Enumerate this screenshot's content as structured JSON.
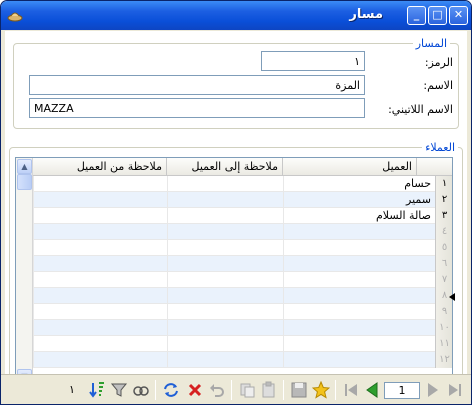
{
  "window": {
    "title": "مسار",
    "close_glyph": "✕",
    "maximize_glyph": "□",
    "minimize_glyph": "_"
  },
  "route_group": {
    "legend": "المسار",
    "code_label": "الرمز:",
    "code_value": "١",
    "name_label": "الاسم:",
    "name_value": "المزة",
    "latin_name_label": "الاسم اللاتيني:",
    "latin_name_value": "MAZZA"
  },
  "clients_group": {
    "legend": "العملاء",
    "columns": [
      "العميل",
      "ملاحظة إلى العميل",
      "ملاحظة من العميل"
    ],
    "rows": [
      {
        "num": "١",
        "client": "حسام",
        "note_to": "",
        "note_from": ""
      },
      {
        "num": "٢",
        "client": "سمير",
        "note_to": "",
        "note_from": ""
      },
      {
        "num": "٣",
        "client": "صالة السلام",
        "note_to": "",
        "note_from": ""
      },
      {
        "num": "٤",
        "client": "",
        "note_to": "",
        "note_from": ""
      },
      {
        "num": "٥",
        "client": "",
        "note_to": "",
        "note_from": ""
      },
      {
        "num": "٦",
        "client": "",
        "note_to": "",
        "note_from": ""
      },
      {
        "num": "٧",
        "client": "",
        "note_to": "",
        "note_from": ""
      },
      {
        "num": "٨",
        "client": "",
        "note_to": "",
        "note_from": ""
      },
      {
        "num": "٩",
        "client": "",
        "note_to": "",
        "note_from": ""
      },
      {
        "num": "١٠",
        "client": "",
        "note_to": "",
        "note_from": ""
      },
      {
        "num": "١١",
        "client": "",
        "note_to": "",
        "note_from": ""
      },
      {
        "num": "١٢",
        "client": "",
        "note_to": "",
        "note_from": ""
      }
    ]
  },
  "toolbar": {
    "current_page": "1",
    "record_count": "١",
    "icons": [
      "last-record-icon",
      "next-record-icon",
      "prev-record-icon",
      "first-record-icon",
      "favorite-icon",
      "save-icon",
      "paste-icon",
      "copy-icon",
      "undo-icon",
      "delete-icon",
      "refresh-icon",
      "view-icon",
      "filter-icon",
      "sort-icon"
    ],
    "accent_green": "#2e9e2e",
    "accent_blue": "#1f5fd6",
    "accent_red": "#d62020"
  }
}
